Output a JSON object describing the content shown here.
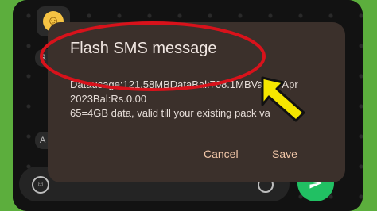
{
  "dialog": {
    "title": "Flash SMS message",
    "message": "Datausage:121.58MBDataBal:708.1MBVal:03 Apr 2023Bal:Rs.0.00\n65=4GB data, valid till your existing pack va",
    "cancel_label": "Cancel",
    "save_label": "Save"
  },
  "chat": {
    "side_bubble_1": "R",
    "side_bubble_2": "A"
  },
  "colors": {
    "dialog_bg": "#3b302b",
    "button_text": "#f1c6a8",
    "highlight_red": "#d8121b",
    "arrow_yellow": "#f5e600",
    "send_green": "#21c063"
  }
}
